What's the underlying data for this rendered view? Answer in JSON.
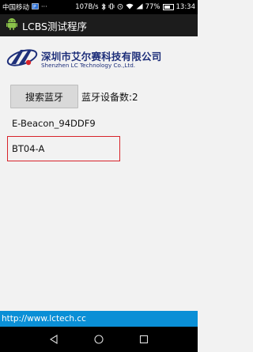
{
  "status_bar": {
    "carrier": "中国移动",
    "speed": "107B/s",
    "battery": "77%",
    "battery_level": 0.77,
    "time": "13:34",
    "icons": [
      "notification-icon",
      "more-icon",
      "bluetooth-icon",
      "vibrate-icon",
      "alarm-icon",
      "wifi-icon",
      "signal-icon",
      "battery-icon"
    ]
  },
  "app_bar": {
    "title": "LCBS测试程序",
    "icon": "android-icon"
  },
  "logo": {
    "company_cn": "深圳市艾尔赛科技有限公司",
    "company_en": "Shenzhen LC Technology Co.,Ltd.",
    "accent": "#1e2f7a"
  },
  "controls": {
    "search_button": "搜索蓝牙",
    "device_count": "蓝牙设备数:2"
  },
  "devices": [
    {
      "name": "E-Beacon_94DDF9",
      "selected": false
    },
    {
      "name": "BT04-A",
      "selected": true
    }
  ],
  "footer": {
    "url": "http://www.lctech.cc",
    "color": "#0a8fd6"
  },
  "nav": {
    "buttons": [
      "back-icon",
      "home-icon",
      "recents-icon"
    ]
  }
}
